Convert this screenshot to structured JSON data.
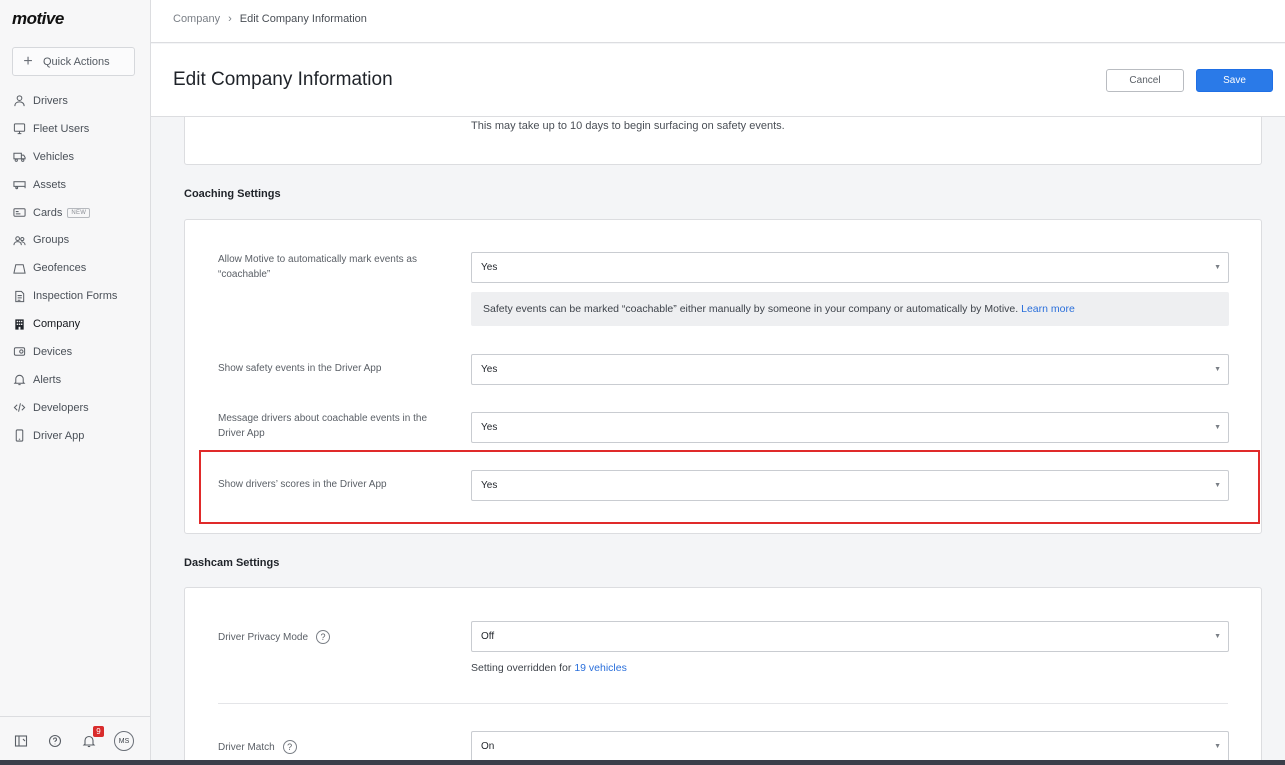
{
  "app": {
    "logo": "motive"
  },
  "sidebar": {
    "quick_actions": "Quick Actions",
    "items": [
      {
        "label": "Drivers",
        "icon": "user-icon"
      },
      {
        "label": "Fleet Users",
        "icon": "monitor-icon"
      },
      {
        "label": "Vehicles",
        "icon": "truck-icon"
      },
      {
        "label": "Assets",
        "icon": "trailer-icon"
      },
      {
        "label": "Cards",
        "icon": "card-icon",
        "badge": "NEW"
      },
      {
        "label": "Groups",
        "icon": "groups-icon"
      },
      {
        "label": "Geofences",
        "icon": "geofence-icon"
      },
      {
        "label": "Inspection Forms",
        "icon": "form-icon"
      },
      {
        "label": "Company",
        "icon": "building-icon",
        "active": true
      },
      {
        "label": "Devices",
        "icon": "device-icon"
      },
      {
        "label": "Alerts",
        "icon": "bell-icon"
      },
      {
        "label": "Developers",
        "icon": "code-icon"
      },
      {
        "label": "Driver App",
        "icon": "phone-icon"
      }
    ],
    "footer": {
      "notification_count": "9",
      "avatar_initials": "MS"
    }
  },
  "breadcrumb": {
    "parent": "Company",
    "separator": "›",
    "current": "Edit Company Information"
  },
  "header": {
    "title": "Edit Company Information",
    "cancel_label": "Cancel",
    "save_label": "Save"
  },
  "top_card": {
    "note": "This may take up to 10 days to begin surfacing on safety events."
  },
  "coaching": {
    "title": "Coaching Settings",
    "auto_mark": {
      "label": "Allow Motive to automatically mark events as “coachable”",
      "value": "Yes",
      "info": "Safety events can be marked “coachable” either manually by someone in your company or automatically by Motive.",
      "info_link": "Learn more"
    },
    "show_events": {
      "label": "Show safety events in the Driver App",
      "value": "Yes"
    },
    "message_drivers": {
      "label": "Message drivers about coachable events in the Driver App",
      "value": "Yes"
    },
    "show_scores": {
      "label": "Show drivers’ scores in the Driver App",
      "value": "Yes"
    }
  },
  "dashcam": {
    "title": "Dashcam Settings",
    "privacy_mode": {
      "label": "Driver Privacy Mode",
      "value": "Off",
      "override_prefix": "Setting overridden for",
      "override_link": "19 vehicles"
    },
    "driver_match": {
      "label": "Driver Match",
      "value": "On"
    }
  },
  "colors": {
    "accent": "#2a7ae8",
    "highlight": "#e02a2a",
    "notification": "#d92c2c"
  }
}
